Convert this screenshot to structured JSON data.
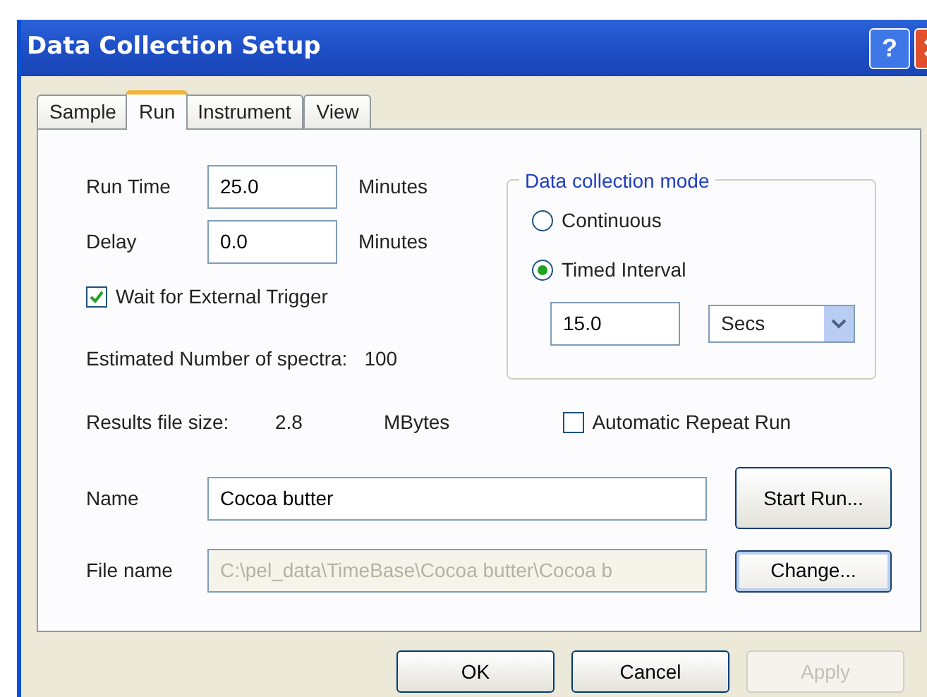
{
  "window": {
    "title": "Data Collection Setup",
    "help_button": "?"
  },
  "tabs": [
    {
      "label": "Sample",
      "selected": false
    },
    {
      "label": "Run",
      "selected": true
    },
    {
      "label": "Instrument",
      "selected": false
    },
    {
      "label": "View",
      "selected": false
    }
  ],
  "run_time": {
    "label": "Run Time",
    "value": "25.0",
    "unit": "Minutes"
  },
  "delay": {
    "label": "Delay",
    "value": "0.0",
    "unit": "Minutes"
  },
  "wait_trigger": {
    "label": "Wait for External Trigger",
    "checked": true
  },
  "estimated": {
    "label": "Estimated Number of spectra:",
    "value": "100"
  },
  "file_size": {
    "label": "Results file size:",
    "value": "2.8",
    "unit": "MBytes"
  },
  "mode_group": {
    "title": "Data collection mode",
    "options": [
      {
        "label": "Continuous",
        "selected": false
      },
      {
        "label": "Timed Interval",
        "selected": true
      }
    ],
    "interval": "15.0",
    "interval_unit": "Secs"
  },
  "auto_repeat": {
    "label": "Automatic Repeat Run",
    "checked": false
  },
  "name": {
    "label": "Name",
    "value": "Cocoa butter"
  },
  "start_button": "Start Run...",
  "file_name": {
    "label": "File name",
    "value": "C:\\pel_data\\TimeBase\\Cocoa butter\\Cocoa b",
    "disabled": true
  },
  "change_button": "Change...",
  "buttons": [
    {
      "label": "OK",
      "disabled": false
    },
    {
      "label": "Cancel",
      "disabled": false
    },
    {
      "label": "Apply",
      "disabled": true
    }
  ]
}
